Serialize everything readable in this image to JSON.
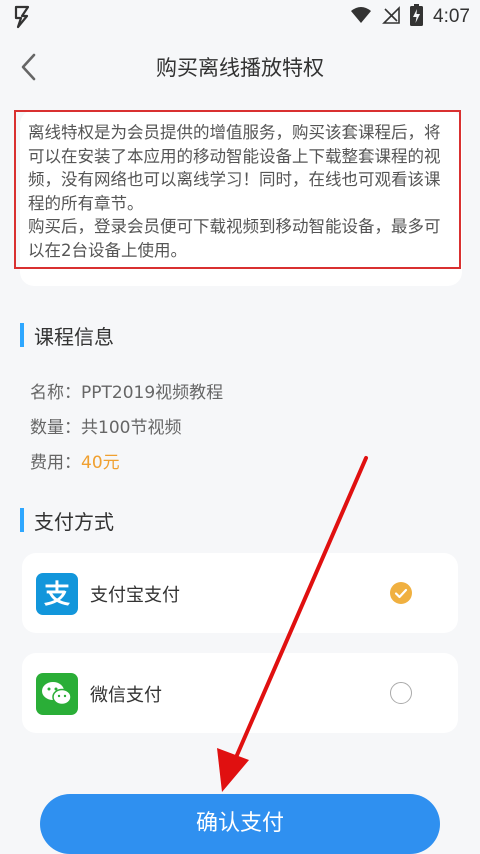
{
  "status_bar": {
    "time": "4:07",
    "notification_icon": "bolt-icon"
  },
  "header": {
    "title": "购买离线播放特权",
    "back_icon": "back-chevron-icon"
  },
  "notice": {
    "paragraph1": "离线特权是为会员提供的增值服务，购买该套课程后，将可以在安装了本应用的移动智能设备上下载整套课程的视频，没有网络也可以离线学习！同时，在线也可观看该课程的所有章节。",
    "paragraph2": "购买后，登录会员便可下载视频到移动智能设备，最多可以在2台设备上使用。"
  },
  "course_info": {
    "section_title": "课程信息",
    "name_label": "名称：",
    "name_value": "PPT2019视频教程",
    "count_label": "数量：",
    "count_value": "共100节视频",
    "price_label": "费用：",
    "price_value": "40元"
  },
  "payment": {
    "section_title": "支付方式",
    "options": [
      {
        "label": "支付宝支付",
        "icon": "alipay-icon",
        "selected": true,
        "icon_text": "支"
      },
      {
        "label": "微信支付",
        "icon": "wechat-icon",
        "selected": false
      }
    ]
  },
  "confirm_button": {
    "label": "确认支付"
  },
  "colors": {
    "accent": "#2f90f0",
    "section_bar": "#2ea7ff",
    "price": "#f0a030",
    "annotation": "#e01010",
    "alipay": "#1296db",
    "wechat": "#2aae37"
  }
}
